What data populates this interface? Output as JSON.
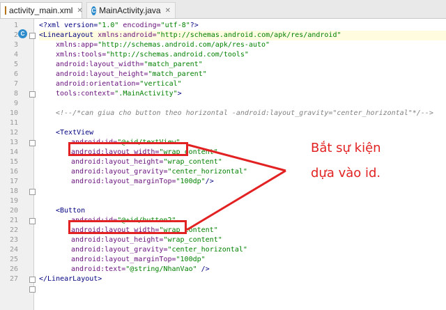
{
  "tabs": [
    {
      "label": "activity_main.xml",
      "active": true,
      "icon": "xml-file-icon"
    },
    {
      "label": "MainActivity.java",
      "active": false,
      "icon": "java-class-icon"
    }
  ],
  "line_numbers": [
    "1",
    "2",
    "3",
    "4",
    "5",
    "6",
    "7",
    "8",
    "9",
    "10",
    "11",
    "12",
    "13",
    "14",
    "15",
    "16",
    "17",
    "18",
    "19",
    "20",
    "21",
    "22",
    "23",
    "24",
    "25",
    "26",
    "27"
  ],
  "code": {
    "l1": {
      "a": "<?xml version=",
      "b": "\"1.0\"",
      "c": " encoding=",
      "d": "\"utf-8\"",
      "e": "?>"
    },
    "l2": {
      "a": "<LinearLayout ",
      "b": "xmlns:android=",
      "c": "\"http://schemas.android.com/apk/res/android\""
    },
    "l3": {
      "a": "xmlns:app=",
      "b": "\"http://schemas.android.com/apk/res-auto\""
    },
    "l4": {
      "a": "xmlns:tools=",
      "b": "\"http://schemas.android.com/tools\""
    },
    "l5": {
      "a": "android:layout_width=",
      "b": "\"match_parent\""
    },
    "l6": {
      "a": "android:layout_height=",
      "b": "\"match_parent\""
    },
    "l7": {
      "a": "android:orientation=",
      "b": "\"vertical\""
    },
    "l8": {
      "a": "tools:context=",
      "b": "\".MainActivity\"",
      "c": ">"
    },
    "l10": "<!--/*can giua cho button theo horizontal -android:layout_gravity=\"center_horizontal\"*/-->",
    "l12": "<TextView",
    "l13": {
      "a": "android:id=",
      "b": "\"@+id/textView\""
    },
    "l14": {
      "a": "android:layout_width=",
      "b": "\"wrap_content\""
    },
    "l15": {
      "a": "android:layout_height=",
      "b": "\"wrap_content\""
    },
    "l16": {
      "a": "android:layout_gravity=",
      "b": "\"center_horizontal\""
    },
    "l17": {
      "a": "android:layout_marginTop=",
      "b": "\"100dp\"",
      "c": "/>"
    },
    "l20": "<Button",
    "l21": {
      "a": "android:id=",
      "b": "\"@+id/button2\""
    },
    "l22": {
      "a": "android:layout_width=",
      "b": "\"wrap_content\""
    },
    "l23": {
      "a": "android:layout_height=",
      "b": "\"wrap_content\""
    },
    "l24": {
      "a": "android:layout_gravity=",
      "b": "\"center_horizontal\""
    },
    "l25": {
      "a": "android:layout_marginTop=",
      "b": "\"100dp\""
    },
    "l26": {
      "a": "android:text=",
      "b": "\"@string/NhanVao\"",
      "c": " />"
    },
    "l27": "</LinearLayout>"
  },
  "annotation": {
    "line1": "Bắt sự kiện",
    "line2": "dựa vào id."
  },
  "colors": {
    "annotation": "#e22222",
    "tag": "#000080",
    "attribute": "#660e7a",
    "value": "#008000",
    "comment": "#808080"
  }
}
